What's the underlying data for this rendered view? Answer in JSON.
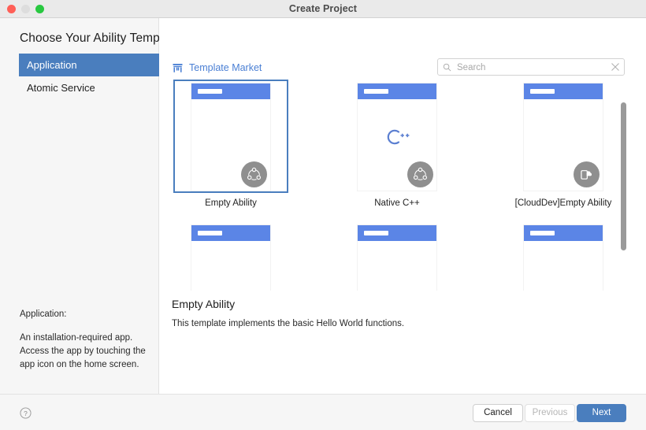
{
  "window": {
    "title": "Create Project",
    "traffic_lights": [
      "close",
      "minimize",
      "maximize"
    ]
  },
  "sidebar": {
    "heading": "Choose Your Ability Template",
    "items": [
      {
        "label": "Application",
        "selected": true
      },
      {
        "label": "Atomic Service",
        "selected": false
      }
    ],
    "description_heading": "Application:",
    "description_body": "An installation-required app. Access the app by touching the app icon on the home screen."
  },
  "main": {
    "market_link": "Template Market",
    "market_icon": "store-icon",
    "search": {
      "placeholder": "Search",
      "value": "",
      "search_icon": "search-icon",
      "clear_icon": "close-icon"
    },
    "templates": [
      {
        "label": "Empty Ability",
        "badge": "distributed-icon",
        "glyph": "",
        "selected": true
      },
      {
        "label": "Native C++",
        "badge": "distributed-icon",
        "glyph": "C++",
        "selected": false
      },
      {
        "label": "[CloudDev]Empty Ability",
        "badge": "cloud-dev-icon",
        "glyph": "",
        "selected": false
      },
      {
        "label": "",
        "badge": "wearable-icon",
        "glyph": "",
        "selected": false
      },
      {
        "label": "",
        "badge": "multi-device-icon",
        "glyph": "",
        "selected": false
      },
      {
        "label": "",
        "badge": "multi-device-icon",
        "glyph": "",
        "selected": false
      }
    ],
    "detail": {
      "title": "Empty Ability",
      "description": "This template implements the basic Hello World functions."
    },
    "scrollbar": {
      "orientation": "vertical"
    }
  },
  "footer": {
    "help_icon": "help-icon",
    "cancel_label": "Cancel",
    "previous_label": "Previous",
    "next_label": "Next"
  },
  "colors": {
    "accent": "#4a7ebe",
    "card_header": "#5b85e6",
    "link": "#4a7fd4",
    "badge": "#8f8f8f"
  }
}
